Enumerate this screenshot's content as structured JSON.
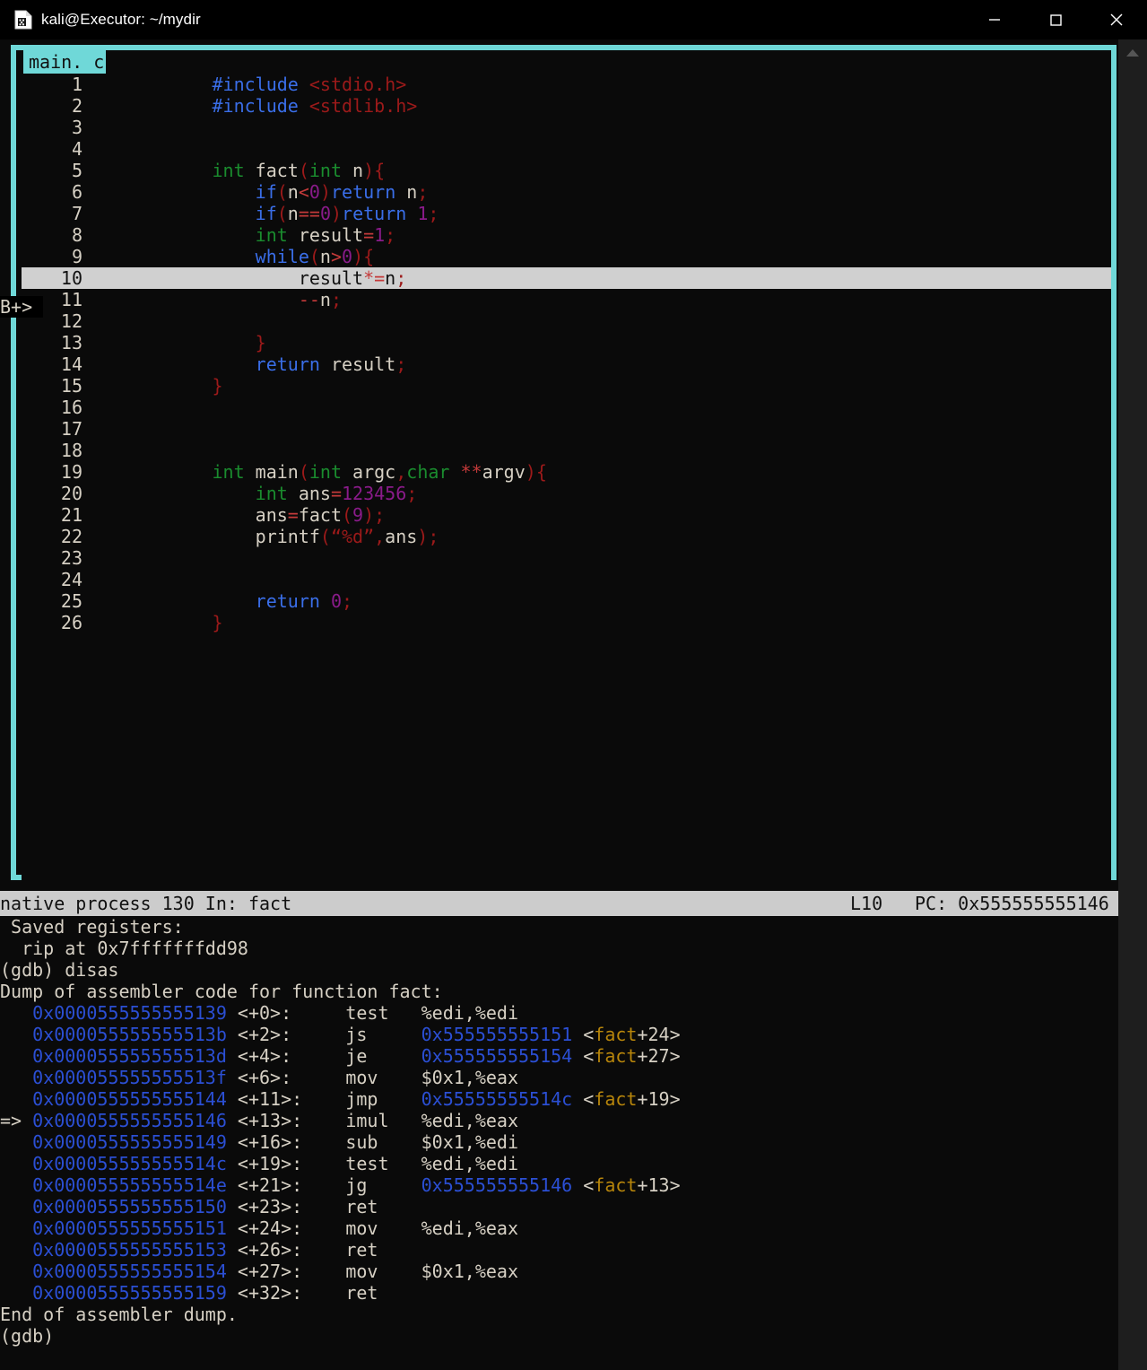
{
  "window": {
    "title": "kali@Executor: ~/mydir",
    "icon": "terminal-document-icon",
    "controls": {
      "minimize": "minimize-icon",
      "maximize": "maximize-icon",
      "close": "close-icon"
    }
  },
  "source_panel": {
    "title": "main. c",
    "corner": "┌",
    "marker": "B+>",
    "highlighted_line": 10,
    "lines": [
      {
        "n": "1",
        "tokens": [
          {
            "t": "            ",
            "c": "plain"
          },
          {
            "t": "#include",
            "c": "kw"
          },
          {
            "t": " ",
            "c": "plain"
          },
          {
            "t": "<stdio.h>",
            "c": "str"
          }
        ]
      },
      {
        "n": "2",
        "tokens": [
          {
            "t": "            ",
            "c": "plain"
          },
          {
            "t": "#include",
            "c": "kw"
          },
          {
            "t": " ",
            "c": "plain"
          },
          {
            "t": "<stdlib.h>",
            "c": "str"
          }
        ]
      },
      {
        "n": "3",
        "tokens": []
      },
      {
        "n": "4",
        "tokens": []
      },
      {
        "n": "5",
        "tokens": [
          {
            "t": "            ",
            "c": "plain"
          },
          {
            "t": "int",
            "c": "ty"
          },
          {
            "t": " fact",
            "c": "plain"
          },
          {
            "t": "(",
            "c": "pun"
          },
          {
            "t": "int",
            "c": "ty"
          },
          {
            "t": " n",
            "c": "plain"
          },
          {
            "t": ")",
            "c": "pun"
          },
          {
            "t": "{",
            "c": "pun"
          }
        ]
      },
      {
        "n": "6",
        "tokens": [
          {
            "t": "                ",
            "c": "plain"
          },
          {
            "t": "if",
            "c": "kw"
          },
          {
            "t": "(",
            "c": "pun"
          },
          {
            "t": "n",
            "c": "plain"
          },
          {
            "t": "<",
            "c": "op"
          },
          {
            "t": "0",
            "c": "num"
          },
          {
            "t": ")",
            "c": "pun"
          },
          {
            "t": "return",
            "c": "kw"
          },
          {
            "t": " n",
            "c": "plain"
          },
          {
            "t": ";",
            "c": "pun"
          }
        ]
      },
      {
        "n": "7",
        "tokens": [
          {
            "t": "                ",
            "c": "plain"
          },
          {
            "t": "if",
            "c": "kw"
          },
          {
            "t": "(",
            "c": "pun"
          },
          {
            "t": "n",
            "c": "plain"
          },
          {
            "t": "==",
            "c": "op"
          },
          {
            "t": "0",
            "c": "num"
          },
          {
            "t": ")",
            "c": "pun"
          },
          {
            "t": "return",
            "c": "kw"
          },
          {
            "t": " ",
            "c": "plain"
          },
          {
            "t": "1",
            "c": "num"
          },
          {
            "t": ";",
            "c": "pun"
          }
        ]
      },
      {
        "n": "8",
        "tokens": [
          {
            "t": "                ",
            "c": "plain"
          },
          {
            "t": "int",
            "c": "ty"
          },
          {
            "t": " result",
            "c": "plain"
          },
          {
            "t": "=",
            "c": "op"
          },
          {
            "t": "1",
            "c": "num"
          },
          {
            "t": ";",
            "c": "pun"
          }
        ]
      },
      {
        "n": "9",
        "tokens": [
          {
            "t": "                ",
            "c": "plain"
          },
          {
            "t": "while",
            "c": "kw"
          },
          {
            "t": "(",
            "c": "pun"
          },
          {
            "t": "n",
            "c": "plain"
          },
          {
            "t": ">",
            "c": "op"
          },
          {
            "t": "0",
            "c": "num"
          },
          {
            "t": ")",
            "c": "pun"
          },
          {
            "t": "{",
            "c": "pun"
          }
        ]
      },
      {
        "n": "10",
        "tokens": [
          {
            "t": "                    ",
            "c": "plain"
          },
          {
            "t": "result",
            "c": "plain"
          },
          {
            "t": "*=",
            "c": "op"
          },
          {
            "t": "n",
            "c": "plain"
          },
          {
            "t": ";",
            "c": "pun"
          }
        ]
      },
      {
        "n": "11",
        "tokens": [
          {
            "t": "                    ",
            "c": "plain"
          },
          {
            "t": "--",
            "c": "op"
          },
          {
            "t": "n",
            "c": "plain"
          },
          {
            "t": ";",
            "c": "pun"
          }
        ]
      },
      {
        "n": "12",
        "tokens": []
      },
      {
        "n": "13",
        "tokens": [
          {
            "t": "                ",
            "c": "plain"
          },
          {
            "t": "}",
            "c": "pun"
          }
        ]
      },
      {
        "n": "14",
        "tokens": [
          {
            "t": "                ",
            "c": "plain"
          },
          {
            "t": "return",
            "c": "kw"
          },
          {
            "t": " result",
            "c": "plain"
          },
          {
            "t": ";",
            "c": "pun"
          }
        ]
      },
      {
        "n": "15",
        "tokens": [
          {
            "t": "            ",
            "c": "plain"
          },
          {
            "t": "}",
            "c": "pun"
          }
        ]
      },
      {
        "n": "16",
        "tokens": []
      },
      {
        "n": "17",
        "tokens": []
      },
      {
        "n": "18",
        "tokens": []
      },
      {
        "n": "19",
        "tokens": [
          {
            "t": "            ",
            "c": "plain"
          },
          {
            "t": "int",
            "c": "ty"
          },
          {
            "t": " main",
            "c": "plain"
          },
          {
            "t": "(",
            "c": "pun"
          },
          {
            "t": "int",
            "c": "ty"
          },
          {
            "t": " argc",
            "c": "plain"
          },
          {
            "t": ",",
            "c": "pun"
          },
          {
            "t": "char",
            "c": "ty"
          },
          {
            "t": " ",
            "c": "plain"
          },
          {
            "t": "**",
            "c": "op"
          },
          {
            "t": "argv",
            "c": "plain"
          },
          {
            "t": ")",
            "c": "pun"
          },
          {
            "t": "{",
            "c": "pun"
          }
        ]
      },
      {
        "n": "20",
        "tokens": [
          {
            "t": "                ",
            "c": "plain"
          },
          {
            "t": "int",
            "c": "ty"
          },
          {
            "t": " ans",
            "c": "plain"
          },
          {
            "t": "=",
            "c": "op"
          },
          {
            "t": "123456",
            "c": "num"
          },
          {
            "t": ";",
            "c": "pun"
          }
        ]
      },
      {
        "n": "21",
        "tokens": [
          {
            "t": "                ",
            "c": "plain"
          },
          {
            "t": "ans",
            "c": "plain"
          },
          {
            "t": "=",
            "c": "op"
          },
          {
            "t": "fact",
            "c": "plain"
          },
          {
            "t": "(",
            "c": "pun"
          },
          {
            "t": "9",
            "c": "num"
          },
          {
            "t": ")",
            "c": "pun"
          },
          {
            "t": ";",
            "c": "pun"
          }
        ]
      },
      {
        "n": "22",
        "tokens": [
          {
            "t": "                ",
            "c": "plain"
          },
          {
            "t": "printf",
            "c": "plain"
          },
          {
            "t": "(",
            "c": "pun"
          },
          {
            "t": "“%d”",
            "c": "str"
          },
          {
            "t": ",",
            "c": "pun"
          },
          {
            "t": "ans",
            "c": "plain"
          },
          {
            "t": ")",
            "c": "pun"
          },
          {
            "t": ";",
            "c": "pun"
          }
        ]
      },
      {
        "n": "23",
        "tokens": []
      },
      {
        "n": "24",
        "tokens": []
      },
      {
        "n": "25",
        "tokens": [
          {
            "t": "                ",
            "c": "plain"
          },
          {
            "t": "return",
            "c": "kw"
          },
          {
            "t": " ",
            "c": "plain"
          },
          {
            "t": "0",
            "c": "num"
          },
          {
            "t": ";",
            "c": "pun"
          }
        ]
      },
      {
        "n": "26",
        "tokens": [
          {
            "t": "            ",
            "c": "plain"
          },
          {
            "t": "}",
            "c": "pun"
          }
        ]
      }
    ]
  },
  "status_bar": {
    "left": "native process 130 In: fact",
    "line": "L10",
    "pc_label": "PC: 0x555555555146"
  },
  "console": {
    "lines": [
      [
        {
          "t": " Saved registers:",
          "c": "gplain"
        }
      ],
      [
        {
          "t": "  rip at 0x7fffffffdd98",
          "c": "gplain"
        }
      ],
      [
        {
          "t": "(gdb) disas",
          "c": "gplain"
        }
      ],
      [
        {
          "t": "Dump of assembler code for function fact:",
          "c": "gplain"
        }
      ],
      [
        {
          "t": "   ",
          "c": "gplain"
        },
        {
          "t": "0x0000555555555139",
          "c": "addr"
        },
        {
          "t": " <+0>:     test   %edi,%edi",
          "c": "gplain"
        }
      ],
      [
        {
          "t": "   ",
          "c": "gplain"
        },
        {
          "t": "0x000055555555513b",
          "c": "addr"
        },
        {
          "t": " <+2>:     js     ",
          "c": "gplain"
        },
        {
          "t": "0x555555555151",
          "c": "addr"
        },
        {
          "t": " <",
          "c": "gplain"
        },
        {
          "t": "fact",
          "c": "sym"
        },
        {
          "t": "+24>",
          "c": "gplain"
        }
      ],
      [
        {
          "t": "   ",
          "c": "gplain"
        },
        {
          "t": "0x000055555555513d",
          "c": "addr"
        },
        {
          "t": " <+4>:     je     ",
          "c": "gplain"
        },
        {
          "t": "0x555555555154",
          "c": "addr"
        },
        {
          "t": " <",
          "c": "gplain"
        },
        {
          "t": "fact",
          "c": "sym"
        },
        {
          "t": "+27>",
          "c": "gplain"
        }
      ],
      [
        {
          "t": "   ",
          "c": "gplain"
        },
        {
          "t": "0x000055555555513f",
          "c": "addr"
        },
        {
          "t": " <+6>:     mov    $0x1,%eax",
          "c": "gplain"
        }
      ],
      [
        {
          "t": "   ",
          "c": "gplain"
        },
        {
          "t": "0x0000555555555144",
          "c": "addr"
        },
        {
          "t": " <+11>:    jmp    ",
          "c": "gplain"
        },
        {
          "t": "0x55555555514c",
          "c": "addr"
        },
        {
          "t": " <",
          "c": "gplain"
        },
        {
          "t": "fact",
          "c": "sym"
        },
        {
          "t": "+19>",
          "c": "gplain"
        }
      ],
      [
        {
          "t": "=> ",
          "c": "gplain"
        },
        {
          "t": "0x0000555555555146",
          "c": "addr"
        },
        {
          "t": " <+13>:    imul   %edi,%eax",
          "c": "gplain"
        }
      ],
      [
        {
          "t": "   ",
          "c": "gplain"
        },
        {
          "t": "0x0000555555555149",
          "c": "addr"
        },
        {
          "t": " <+16>:    sub    $0x1,%edi",
          "c": "gplain"
        }
      ],
      [
        {
          "t": "   ",
          "c": "gplain"
        },
        {
          "t": "0x000055555555514c",
          "c": "addr"
        },
        {
          "t": " <+19>:    test   %edi,%edi",
          "c": "gplain"
        }
      ],
      [
        {
          "t": "   ",
          "c": "gplain"
        },
        {
          "t": "0x000055555555514e",
          "c": "addr"
        },
        {
          "t": " <+21>:    jg     ",
          "c": "gplain"
        },
        {
          "t": "0x555555555146",
          "c": "addr"
        },
        {
          "t": " <",
          "c": "gplain"
        },
        {
          "t": "fact",
          "c": "sym"
        },
        {
          "t": "+13>",
          "c": "gplain"
        }
      ],
      [
        {
          "t": "   ",
          "c": "gplain"
        },
        {
          "t": "0x0000555555555150",
          "c": "addr"
        },
        {
          "t": " <+23>:    ret",
          "c": "gplain"
        }
      ],
      [
        {
          "t": "   ",
          "c": "gplain"
        },
        {
          "t": "0x0000555555555151",
          "c": "addr"
        },
        {
          "t": " <+24>:    mov    %edi,%eax",
          "c": "gplain"
        }
      ],
      [
        {
          "t": "   ",
          "c": "gplain"
        },
        {
          "t": "0x0000555555555153",
          "c": "addr"
        },
        {
          "t": " <+26>:    ret",
          "c": "gplain"
        }
      ],
      [
        {
          "t": "   ",
          "c": "gplain"
        },
        {
          "t": "0x0000555555555154",
          "c": "addr"
        },
        {
          "t": " <+27>:    mov    $0x1,%eax",
          "c": "gplain"
        }
      ],
      [
        {
          "t": "   ",
          "c": "gplain"
        },
        {
          "t": "0x0000555555555159",
          "c": "addr"
        },
        {
          "t": " <+32>:    ret",
          "c": "gplain"
        }
      ],
      [
        {
          "t": "End of assembler dump.",
          "c": "gplain"
        }
      ],
      [
        {
          "t": "(gdb)",
          "c": "gplain"
        }
      ]
    ]
  },
  "scrollbar": {
    "up_arrow": "scroll-up-arrow-icon"
  },
  "colors": {
    "frame": "#6fd8d8",
    "status_bg": "#cccccc",
    "highlight_bg": "#d0d0d0",
    "address": "#2b4fd4",
    "symbol": "#b8860b",
    "terminal_bg": "#0a0a0a"
  }
}
